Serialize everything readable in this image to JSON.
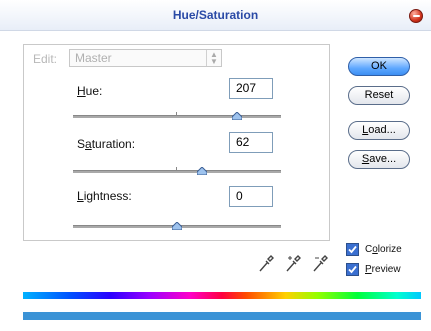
{
  "window": {
    "title": "Hue/Saturation"
  },
  "edit": {
    "label": "Edit:",
    "value": "Master"
  },
  "sliders": [
    {
      "label_prefix": "",
      "label_accel": "H",
      "label_rest": "ue:",
      "value": "207",
      "position": 0.79
    },
    {
      "label_prefix": "S",
      "label_accel": "a",
      "label_rest": "turation:",
      "value": "62",
      "position": 0.62
    },
    {
      "label_prefix": "",
      "label_accel": "L",
      "label_rest": "ightness:",
      "value": "0",
      "position": 0.5
    }
  ],
  "buttons": {
    "ok": "OK",
    "reset": "Reset",
    "load_accel": "L",
    "load_rest": "oad...",
    "save_accel": "S",
    "save_rest": "ave..."
  },
  "checkboxes": {
    "colorize": {
      "accel": "o",
      "prefix": "C",
      "rest": "lorize",
      "checked": true
    },
    "preview": {
      "accel": "P",
      "prefix": "",
      "rest": "review",
      "checked": true
    }
  },
  "icons": [
    "eyedropper-icon",
    "eyedropper-plus-icon",
    "eyedropper-minus-icon"
  ],
  "colors": {
    "accent": "#3d8ef2",
    "title": "#2a4aa6",
    "result_bar": "#3b93d6"
  }
}
